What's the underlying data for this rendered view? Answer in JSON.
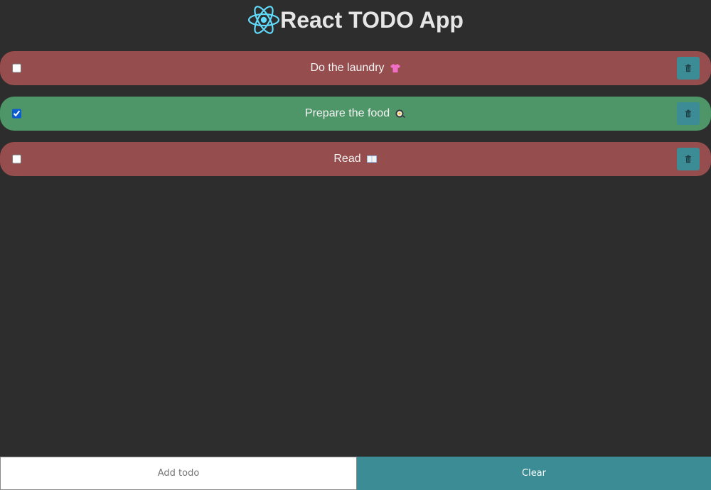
{
  "header": {
    "title": "React TODO App",
    "logo_icon": "react-atom-icon",
    "logo_color": "#61dafb"
  },
  "colors": {
    "background": "#2d2d2d",
    "pending": "#954d4e",
    "done": "#4e9568",
    "accent": "#3b8c95"
  },
  "todos": [
    {
      "text": "Do the laundry",
      "emoji_icon": "tshirt-icon",
      "completed": false
    },
    {
      "text": "Prepare the food",
      "emoji_icon": "frying-pan-icon",
      "completed": true
    },
    {
      "text": "Read",
      "emoji_icon": "book-icon",
      "completed": false
    }
  ],
  "footer": {
    "input_placeholder": "Add todo",
    "input_value": "",
    "clear_label": "Clear"
  }
}
